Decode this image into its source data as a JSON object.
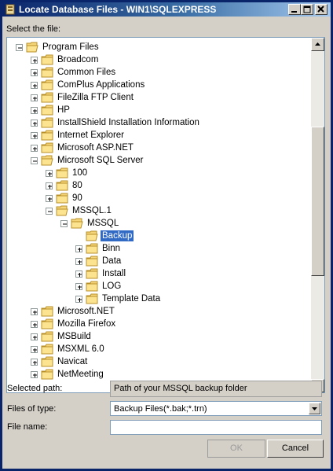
{
  "window": {
    "title": "Locate Database Files - WIN1\\SQLEXPRESS"
  },
  "tree_label": {
    "text": "Select the file:"
  },
  "tree": {
    "items": [
      {
        "label": "Program Files",
        "level": 0,
        "expanded": true,
        "selected": false
      },
      {
        "label": "Broadcom",
        "level": 1,
        "expanded": false,
        "selected": false
      },
      {
        "label": "Common Files",
        "level": 1,
        "expanded": false,
        "selected": false
      },
      {
        "label": "ComPlus Applications",
        "level": 1,
        "expanded": false,
        "selected": false
      },
      {
        "label": "FileZilla FTP Client",
        "level": 1,
        "expanded": false,
        "selected": false
      },
      {
        "label": "HP",
        "level": 1,
        "expanded": false,
        "selected": false
      },
      {
        "label": "InstallShield Installation Information",
        "level": 1,
        "expanded": false,
        "selected": false
      },
      {
        "label": "Internet Explorer",
        "level": 1,
        "expanded": false,
        "selected": false
      },
      {
        "label": "Microsoft ASP.NET",
        "level": 1,
        "expanded": false,
        "selected": false
      },
      {
        "label": "Microsoft SQL Server",
        "level": 1,
        "expanded": true,
        "selected": false
      },
      {
        "label": "100",
        "level": 2,
        "expanded": false,
        "selected": false
      },
      {
        "label": "80",
        "level": 2,
        "expanded": false,
        "selected": false
      },
      {
        "label": "90",
        "level": 2,
        "expanded": false,
        "selected": false
      },
      {
        "label": "MSSQL.1",
        "level": 2,
        "expanded": true,
        "selected": false
      },
      {
        "label": "MSSQL",
        "level": 3,
        "expanded": true,
        "selected": false
      },
      {
        "label": "Backup",
        "level": 4,
        "expanded": null,
        "selected": true
      },
      {
        "label": "Binn",
        "level": 4,
        "expanded": false,
        "selected": false
      },
      {
        "label": "Data",
        "level": 4,
        "expanded": false,
        "selected": false
      },
      {
        "label": "Install",
        "level": 4,
        "expanded": false,
        "selected": false
      },
      {
        "label": "LOG",
        "level": 4,
        "expanded": false,
        "selected": false
      },
      {
        "label": "Template Data",
        "level": 4,
        "expanded": false,
        "selected": false
      },
      {
        "label": "Microsoft.NET",
        "level": 1,
        "expanded": false,
        "selected": false
      },
      {
        "label": "Mozilla Firefox",
        "level": 1,
        "expanded": false,
        "selected": false
      },
      {
        "label": "MSBuild",
        "level": 1,
        "expanded": false,
        "selected": false
      },
      {
        "label": "MSXML 6.0",
        "level": 1,
        "expanded": false,
        "selected": false
      },
      {
        "label": "Navicat",
        "level": 1,
        "expanded": false,
        "selected": false
      },
      {
        "label": "NetMeeting",
        "level": 1,
        "expanded": false,
        "selected": false
      }
    ]
  },
  "selected_path": {
    "label": "Selected path:",
    "value": "Path of your MSSQL backup folder"
  },
  "files_of_type": {
    "label": "Files of type:",
    "value": "Backup Files(*.bak;*.trn)"
  },
  "file_name": {
    "label": "File name:",
    "value": ""
  },
  "buttons": {
    "ok": "OK",
    "cancel": "Cancel"
  },
  "colors": {
    "title_bar": "#0a246a",
    "selection": "#316ac5",
    "face": "#d4d0c8"
  },
  "icons": [
    "app-icon",
    "minimize-icon",
    "maximize-icon",
    "close-icon",
    "folder-icon",
    "expand-plus-icon",
    "collapse-minus-icon",
    "scroll-up-icon",
    "scroll-down-icon",
    "dropdown-arrow-icon"
  ]
}
